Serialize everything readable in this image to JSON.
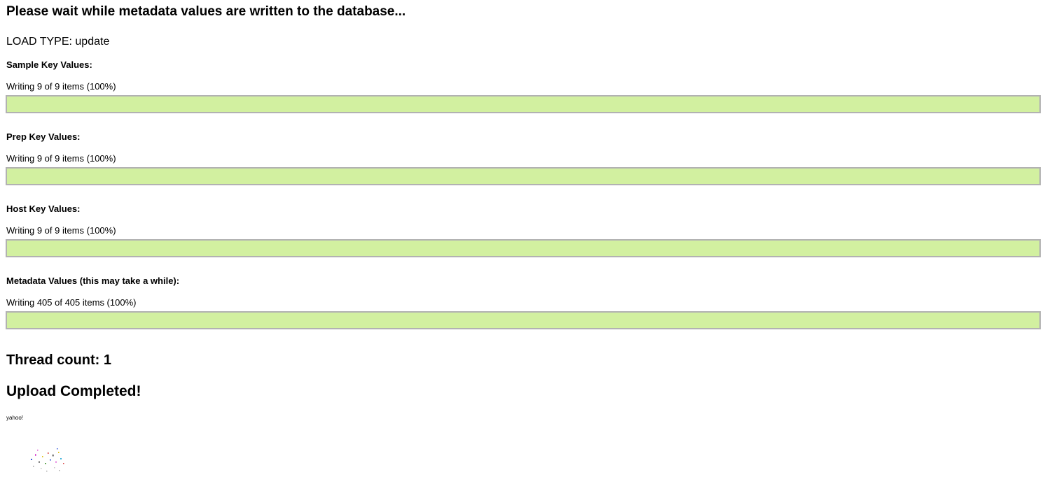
{
  "page": {
    "heading": "Please wait while metadata values are written to the database...",
    "load_type": "LOAD TYPE: update"
  },
  "sections": [
    {
      "title": "Sample Key Values:",
      "status": "Writing 9 of 9 items (100%)",
      "progress": 1.0
    },
    {
      "title": "Prep Key Values:",
      "status": "Writing 9 of 9 items (100%)",
      "progress": 1.0
    },
    {
      "title": "Host Key Values:",
      "status": "Writing 9 of 9 items (100%)",
      "progress": 1.0
    },
    {
      "title": "Metadata Values (this may take a while):",
      "status": "Writing 405 of 405 items (100%)",
      "progress": 1.0
    }
  ],
  "summary": {
    "thread_count": "Thread count: 1",
    "completed": "Upload Completed!",
    "note": "yahoo!"
  },
  "colors": {
    "bar_fill": "#d2f0a0",
    "bar_border": "#b2b2b2"
  },
  "icons": {
    "celebration": "confetti-icon"
  }
}
